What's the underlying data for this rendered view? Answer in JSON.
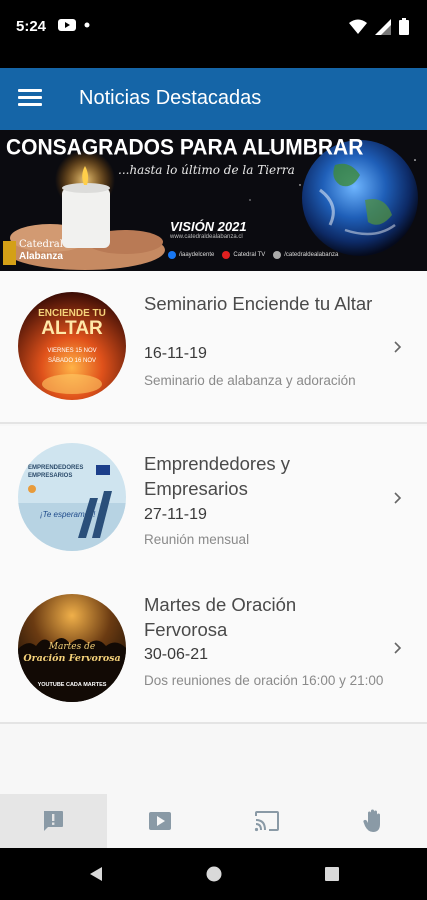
{
  "status_bar": {
    "time": "5:24",
    "icons_left": [
      "youtube-icon",
      "notification-dot-icon"
    ],
    "icons_right": [
      "wifi-icon",
      "signal-icon",
      "battery-icon"
    ]
  },
  "app_bar": {
    "title": "Noticias Destacadas",
    "menu_icon": "hamburger-menu-icon",
    "color": "#1565a7"
  },
  "banner": {
    "title": "CONSAGRADOS PARA ALUMBRAR",
    "subtitle": "...hasta lo último de la Tierra",
    "vision": "VISIÓN 2021",
    "url": "www.catedraldealabanza.cl",
    "social": [
      {
        "icon": "facebook-icon",
        "label": "/iaaydelcente",
        "color": "#1877f2"
      },
      {
        "icon": "youtube-icon",
        "label": "Catedral TV",
        "color": "#e02020"
      },
      {
        "icon": "instagram-icon",
        "label": "/catedraldealabanza",
        "color": "#aaaaaa"
      }
    ],
    "logo": {
      "line1": "Catedral",
      "line2": "Alabanza"
    }
  },
  "news": [
    {
      "title": "Seminario Enciende tu Altar",
      "date": "16-11-19",
      "description": "Seminario de alabanza y adoración",
      "thumb_text": [
        "ENCIENDE TU",
        "ALTAR",
        "VIERNES 15 NOV",
        "SÁBADO 16 NOV"
      ]
    },
    {
      "title": "Emprendedores y Empresarios",
      "date": "27-11-19",
      "description": "Reunión mensual",
      "thumb_text": [
        "EMPRENDEDORES",
        "EMPRESARIOS",
        "¡Te esperamos!"
      ]
    },
    {
      "title": "Martes de Oración Fervorosa",
      "date": "30-06-21",
      "description": "Dos reuniones de oración 16:00 y 21:00",
      "thumb_text": [
        "Martes de",
        "Oración Fervorosa",
        "YOUTUBE CADA MARTES"
      ]
    }
  ],
  "bottom_nav": [
    {
      "icon": "news-alert-icon",
      "active": true
    },
    {
      "icon": "video-play-icon",
      "active": false
    },
    {
      "icon": "cast-icon",
      "active": false
    },
    {
      "icon": "raised-hand-icon",
      "active": false
    }
  ],
  "system_nav": [
    "back-icon",
    "home-icon",
    "recents-icon"
  ]
}
